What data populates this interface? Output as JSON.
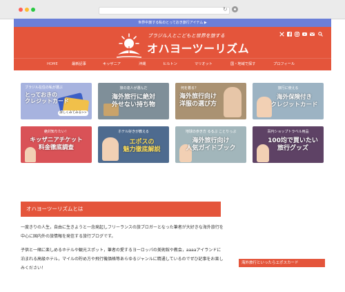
{
  "browser": {
    "colors": {
      "close": "#ff5f57",
      "minimize": "#febc2e",
      "zoom": "#28c840"
    },
    "reload_glyph": "↻"
  },
  "topbar": {
    "text": "世界中旅する私のとっておき旅行アイテム ▶"
  },
  "header": {
    "tagline": "ブラジル人とこどもと世界を旅する",
    "title": "オハヨーツーリズム",
    "social_icons": [
      "x-icon",
      "facebook-icon",
      "instagram-icon",
      "youtube-icon",
      "mail-icon",
      "search-icon"
    ]
  },
  "nav": {
    "items": [
      "HOME",
      "最新記事",
      "キッザニア",
      "沖縄",
      "ヒルトン",
      "マリオット",
      "国・地域で探す",
      "プロフィール"
    ]
  },
  "cards": [
    {
      "label": "とっておきの\nクレジットカード",
      "sub": "ブラジル在住の私が選ぶ",
      "extra": "詳しくみてみる>>",
      "bg": "#9aa8d8"
    },
    {
      "label": "海外旅行に絶対\n外せない持ち物",
      "sub": "旅の達人が選んだ",
      "bg": "#7b8c96"
    },
    {
      "label": "海外旅行向け\n洋服の選び方",
      "sub": "何を着る？",
      "bg": "#a58e6e"
    },
    {
      "label": "海外保険付き\nクレジットカード",
      "sub": "旅行に使える",
      "bg": "#9ab0c0"
    },
    {
      "label": "キッザニアチケット\n料金徹底調査",
      "sub": "絶対知りたい！",
      "bg": "#d94e53"
    },
    {
      "label": "エポスの\n魅力徹底解説",
      "sub": "ホテル好きが教える",
      "bg": "#4c6a8c"
    },
    {
      "label": "海外旅行向け\n人気ガイドブック",
      "sub": "地球の歩き方 るるぶ ことりっぷ",
      "bg": "#9fb3b8"
    },
    {
      "label": "100均で買いたい\n旅行グッズ",
      "sub": "百円ショップトラベル用品",
      "bg": "#5c3f63"
    }
  ],
  "about": {
    "heading": "オハヨーツーリズムとは",
    "paragraph1": "一度きりの人生，自由に生きようと一念発起しフリーランスの旅ブロガーとなった筆者が大好きな海外旅行を中心に国内外の旅情報を発信する旅行ブログです。",
    "paragraph2": "子供と一緒に楽しめるホテルや観光スポット，筆者の愛するヨーロッパの美術館や教会，aaaaアイランドに泊まれる高級ホテル，マイルの貯め方や飛行機価格等あらゆるジャンルに精通しているのでぜひ記事をお楽しみください！"
  },
  "sidebar": {
    "button": "海外旅行といったらエポスカード"
  }
}
